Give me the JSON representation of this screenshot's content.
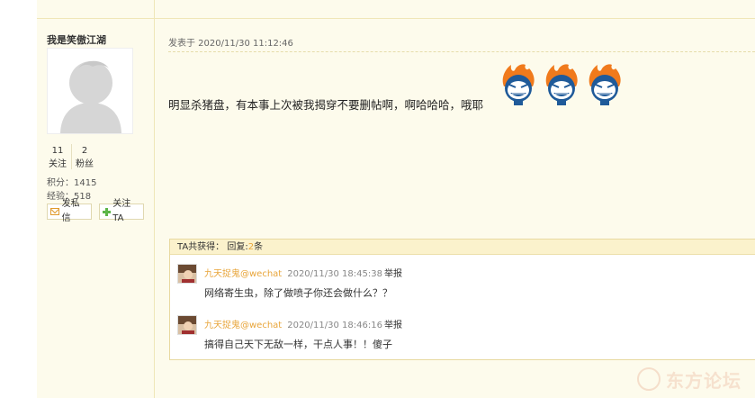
{
  "sidebar": {
    "username": "我是笑傲江湖",
    "follow_count": "11",
    "follow_label": "关注",
    "fans_count": "2",
    "fans_label": "粉丝",
    "score": "积分：1415",
    "exp": "经验：518",
    "msg_button": "发私信",
    "follow_button": "关注TA"
  },
  "post": {
    "date": "发表于 2020/11/30 11:12:46",
    "body": "明显杀猪盘，有本事上次被我揭穿不要删帖啊，啊哈哈哈，哦耶"
  },
  "replies": {
    "header_prefix": "TA共获得： 回复:",
    "header_count": "2",
    "header_suffix": "条",
    "items": [
      {
        "name": "九天捉鬼@wechat",
        "time": "2020/11/30 18:45:38",
        "report": "举报",
        "text": "网络寄生虫，除了做喷子你还会做什么？？"
      },
      {
        "name": "九天捉鬼@wechat",
        "time": "2020/11/30 18:46:16",
        "report": "举报",
        "text": "搞得自己天下无敌一样，干点人事！！傻子"
      }
    ]
  },
  "watermark": "东方论坛",
  "colors": {
    "page_bg": "#fdfbec",
    "accent": "#e8a53a",
    "border": "#e8d9a0"
  }
}
